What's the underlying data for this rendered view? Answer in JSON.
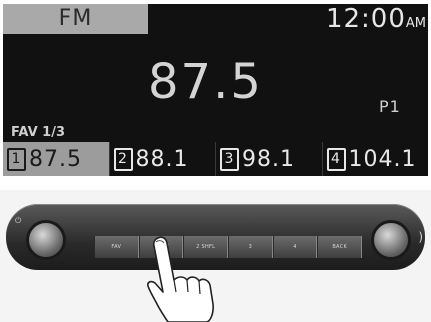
{
  "display": {
    "band": "FM",
    "clock_time": "12:00",
    "clock_ampm": "AM",
    "frequency": "87.5",
    "preset_indicator": "P1",
    "fav_label": "FAV 1/3",
    "presets": [
      {
        "num": "1",
        "freq": "87.5"
      },
      {
        "num": "2",
        "freq": "88.1"
      },
      {
        "num": "3",
        "freq": "98.1"
      },
      {
        "num": "4",
        "freq": "104.1"
      }
    ]
  },
  "panel": {
    "buttons": [
      {
        "label": "FAV",
        "icon": ""
      },
      {
        "label": "1 RPT",
        "icon": ""
      },
      {
        "label": "2 SHFL",
        "icon": ""
      },
      {
        "label": "3",
        "icon": ""
      },
      {
        "label": "4",
        "icon": ""
      },
      {
        "label": "BACK",
        "icon": ""
      }
    ],
    "colors": {
      "display_bg": "#111111",
      "display_text": "#e6e6e6",
      "highlight": "#9c9c9c"
    }
  }
}
